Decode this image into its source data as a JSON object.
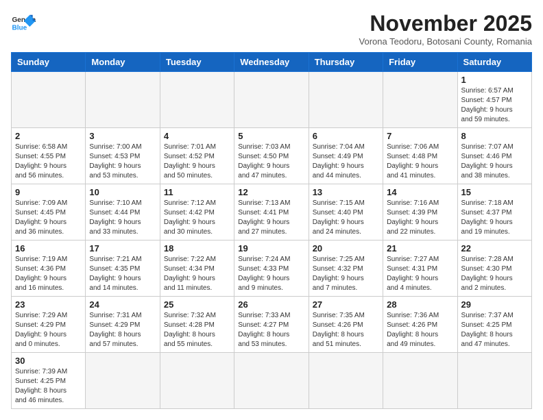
{
  "logo": {
    "text_general": "General",
    "text_blue": "Blue"
  },
  "header": {
    "month_title": "November 2025",
    "subtitle": "Vorona Teodoru, Botosani County, Romania"
  },
  "weekdays": [
    "Sunday",
    "Monday",
    "Tuesday",
    "Wednesday",
    "Thursday",
    "Friday",
    "Saturday"
  ],
  "days": {
    "d1": {
      "num": "1",
      "info": "Sunrise: 6:57 AM\nSunset: 4:57 PM\nDaylight: 9 hours\nand 59 minutes."
    },
    "d2": {
      "num": "2",
      "info": "Sunrise: 6:58 AM\nSunset: 4:55 PM\nDaylight: 9 hours\nand 56 minutes."
    },
    "d3": {
      "num": "3",
      "info": "Sunrise: 7:00 AM\nSunset: 4:53 PM\nDaylight: 9 hours\nand 53 minutes."
    },
    "d4": {
      "num": "4",
      "info": "Sunrise: 7:01 AM\nSunset: 4:52 PM\nDaylight: 9 hours\nand 50 minutes."
    },
    "d5": {
      "num": "5",
      "info": "Sunrise: 7:03 AM\nSunset: 4:50 PM\nDaylight: 9 hours\nand 47 minutes."
    },
    "d6": {
      "num": "6",
      "info": "Sunrise: 7:04 AM\nSunset: 4:49 PM\nDaylight: 9 hours\nand 44 minutes."
    },
    "d7": {
      "num": "7",
      "info": "Sunrise: 7:06 AM\nSunset: 4:48 PM\nDaylight: 9 hours\nand 41 minutes."
    },
    "d8": {
      "num": "8",
      "info": "Sunrise: 7:07 AM\nSunset: 4:46 PM\nDaylight: 9 hours\nand 38 minutes."
    },
    "d9": {
      "num": "9",
      "info": "Sunrise: 7:09 AM\nSunset: 4:45 PM\nDaylight: 9 hours\nand 36 minutes."
    },
    "d10": {
      "num": "10",
      "info": "Sunrise: 7:10 AM\nSunset: 4:44 PM\nDaylight: 9 hours\nand 33 minutes."
    },
    "d11": {
      "num": "11",
      "info": "Sunrise: 7:12 AM\nSunset: 4:42 PM\nDaylight: 9 hours\nand 30 minutes."
    },
    "d12": {
      "num": "12",
      "info": "Sunrise: 7:13 AM\nSunset: 4:41 PM\nDaylight: 9 hours\nand 27 minutes."
    },
    "d13": {
      "num": "13",
      "info": "Sunrise: 7:15 AM\nSunset: 4:40 PM\nDaylight: 9 hours\nand 24 minutes."
    },
    "d14": {
      "num": "14",
      "info": "Sunrise: 7:16 AM\nSunset: 4:39 PM\nDaylight: 9 hours\nand 22 minutes."
    },
    "d15": {
      "num": "15",
      "info": "Sunrise: 7:18 AM\nSunset: 4:37 PM\nDaylight: 9 hours\nand 19 minutes."
    },
    "d16": {
      "num": "16",
      "info": "Sunrise: 7:19 AM\nSunset: 4:36 PM\nDaylight: 9 hours\nand 16 minutes."
    },
    "d17": {
      "num": "17",
      "info": "Sunrise: 7:21 AM\nSunset: 4:35 PM\nDaylight: 9 hours\nand 14 minutes."
    },
    "d18": {
      "num": "18",
      "info": "Sunrise: 7:22 AM\nSunset: 4:34 PM\nDaylight: 9 hours\nand 11 minutes."
    },
    "d19": {
      "num": "19",
      "info": "Sunrise: 7:24 AM\nSunset: 4:33 PM\nDaylight: 9 hours\nand 9 minutes."
    },
    "d20": {
      "num": "20",
      "info": "Sunrise: 7:25 AM\nSunset: 4:32 PM\nDaylight: 9 hours\nand 7 minutes."
    },
    "d21": {
      "num": "21",
      "info": "Sunrise: 7:27 AM\nSunset: 4:31 PM\nDaylight: 9 hours\nand 4 minutes."
    },
    "d22": {
      "num": "22",
      "info": "Sunrise: 7:28 AM\nSunset: 4:30 PM\nDaylight: 9 hours\nand 2 minutes."
    },
    "d23": {
      "num": "23",
      "info": "Sunrise: 7:29 AM\nSunset: 4:29 PM\nDaylight: 9 hours\nand 0 minutes."
    },
    "d24": {
      "num": "24",
      "info": "Sunrise: 7:31 AM\nSunset: 4:29 PM\nDaylight: 8 hours\nand 57 minutes."
    },
    "d25": {
      "num": "25",
      "info": "Sunrise: 7:32 AM\nSunset: 4:28 PM\nDaylight: 8 hours\nand 55 minutes."
    },
    "d26": {
      "num": "26",
      "info": "Sunrise: 7:33 AM\nSunset: 4:27 PM\nDaylight: 8 hours\nand 53 minutes."
    },
    "d27": {
      "num": "27",
      "info": "Sunrise: 7:35 AM\nSunset: 4:26 PM\nDaylight: 8 hours\nand 51 minutes."
    },
    "d28": {
      "num": "28",
      "info": "Sunrise: 7:36 AM\nSunset: 4:26 PM\nDaylight: 8 hours\nand 49 minutes."
    },
    "d29": {
      "num": "29",
      "info": "Sunrise: 7:37 AM\nSunset: 4:25 PM\nDaylight: 8 hours\nand 47 minutes."
    },
    "d30": {
      "num": "30",
      "info": "Sunrise: 7:39 AM\nSunset: 4:25 PM\nDaylight: 8 hours\nand 46 minutes."
    }
  }
}
